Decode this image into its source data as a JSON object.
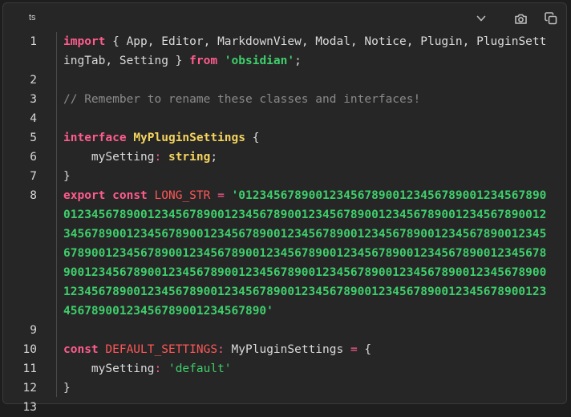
{
  "header": {
    "language": "ts",
    "icons": [
      "chevron-down-icon",
      "camera-icon",
      "copy-icon"
    ]
  },
  "code": {
    "line_numbers": [
      "1",
      "2",
      "3",
      "4",
      "5",
      "6",
      "7",
      "8",
      "9",
      "10",
      "11",
      "12",
      "13"
    ],
    "line1": {
      "import": "import",
      "imports": " { App, Editor, MarkdownView, Modal, Notice, Plugin, PluginSettingTab, Setting } ",
      "from": "from",
      "module": "'obsidian'",
      "semi": ";"
    },
    "line3": {
      "comment": "// Remember to rename these classes and interfaces!"
    },
    "line5": {
      "kw": "interface",
      "name": "MyPluginSettings",
      "brace": " {"
    },
    "line6": {
      "indent": "    ",
      "prop": "mySetting",
      "colon": ": ",
      "type": "string",
      "semi": ";"
    },
    "line7": {
      "brace": "}"
    },
    "line8": {
      "export": "export",
      "const": "const",
      "name": "LONG_STR",
      "eq": "=",
      "value": "'0123456789001234567890012345678900123456789001234567890012345678900123456789001234567890012345678900123456789001234567890012345678900123456789001234567890012345678900123456789001234567890012345678900123456789001234567890012345678900123456789001234567890012345678900123456789001234567890012345678900123456789001234567890012345678900123456789001234567890012345678900123456789001234567890012345678900123456789001234567890'"
    },
    "line10": {
      "const": "const",
      "name": "DEFAULT_SETTINGS",
      "colon": ":",
      "type": " MyPluginSettings ",
      "eq": "=",
      "brace": " {"
    },
    "line11": {
      "indent": "    ",
      "prop": "mySetting",
      "colon": ": ",
      "value": "'default'"
    },
    "line12": {
      "brace": "}"
    }
  }
}
